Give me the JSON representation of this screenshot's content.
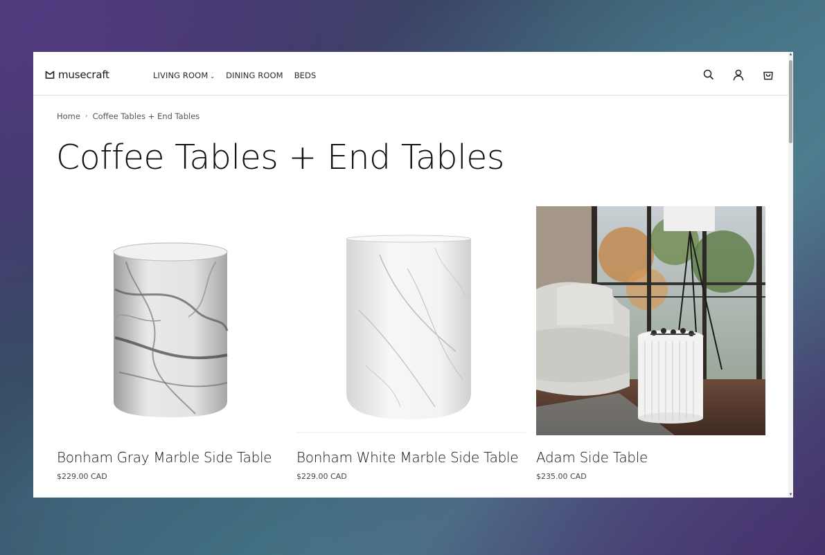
{
  "header": {
    "logo_text": "musecraft",
    "nav": [
      {
        "label": "LIVING ROOM",
        "has_dropdown": true
      },
      {
        "label": "DINING ROOM",
        "has_dropdown": false
      },
      {
        "label": "BEDS",
        "has_dropdown": false
      }
    ],
    "icons": [
      "search-icon",
      "account-icon",
      "cart-icon"
    ]
  },
  "breadcrumb": {
    "items": [
      "Home",
      "Coffee Tables + End Tables"
    ],
    "separator": "›"
  },
  "page": {
    "title": "Coffee Tables + End Tables"
  },
  "products": [
    {
      "title": "Bonham Gray Marble Side Table",
      "price": "$229.00 CAD",
      "image": "gray marble cylindrical side table"
    },
    {
      "title": "Bonham White Marble Side Table",
      "price": "$229.00 CAD",
      "image": "white marble cylindrical side table"
    },
    {
      "title": "Adam Side Table",
      "price": "$235.00 CAD",
      "image": "white fluted side table in living room"
    }
  ],
  "colors": {
    "text": "#111111",
    "muted": "#555555",
    "border": "#e2e2e2"
  }
}
